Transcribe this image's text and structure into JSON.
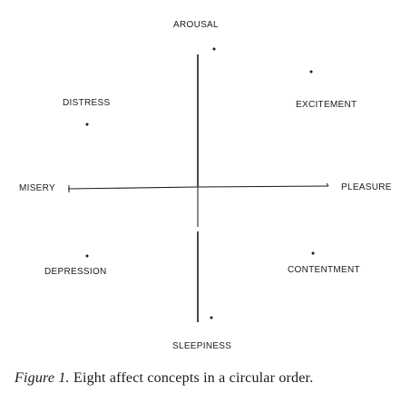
{
  "labels": {
    "arousal": "AROUSAL",
    "distress": "DISTRESS",
    "excitement": "EXCITEMENT",
    "misery": "MISERY",
    "pleasure": "PLEASURE",
    "depression": "DEPRESSION",
    "contentment": "CONTENTMENT",
    "sleepiness": "SLEEPINESS"
  },
  "caption": {
    "figure_label": "Figure 1.",
    "text": "Eight affect concepts in a circular order."
  },
  "colors": {
    "ink": "#1a1a1a",
    "background": "#ffffff"
  }
}
